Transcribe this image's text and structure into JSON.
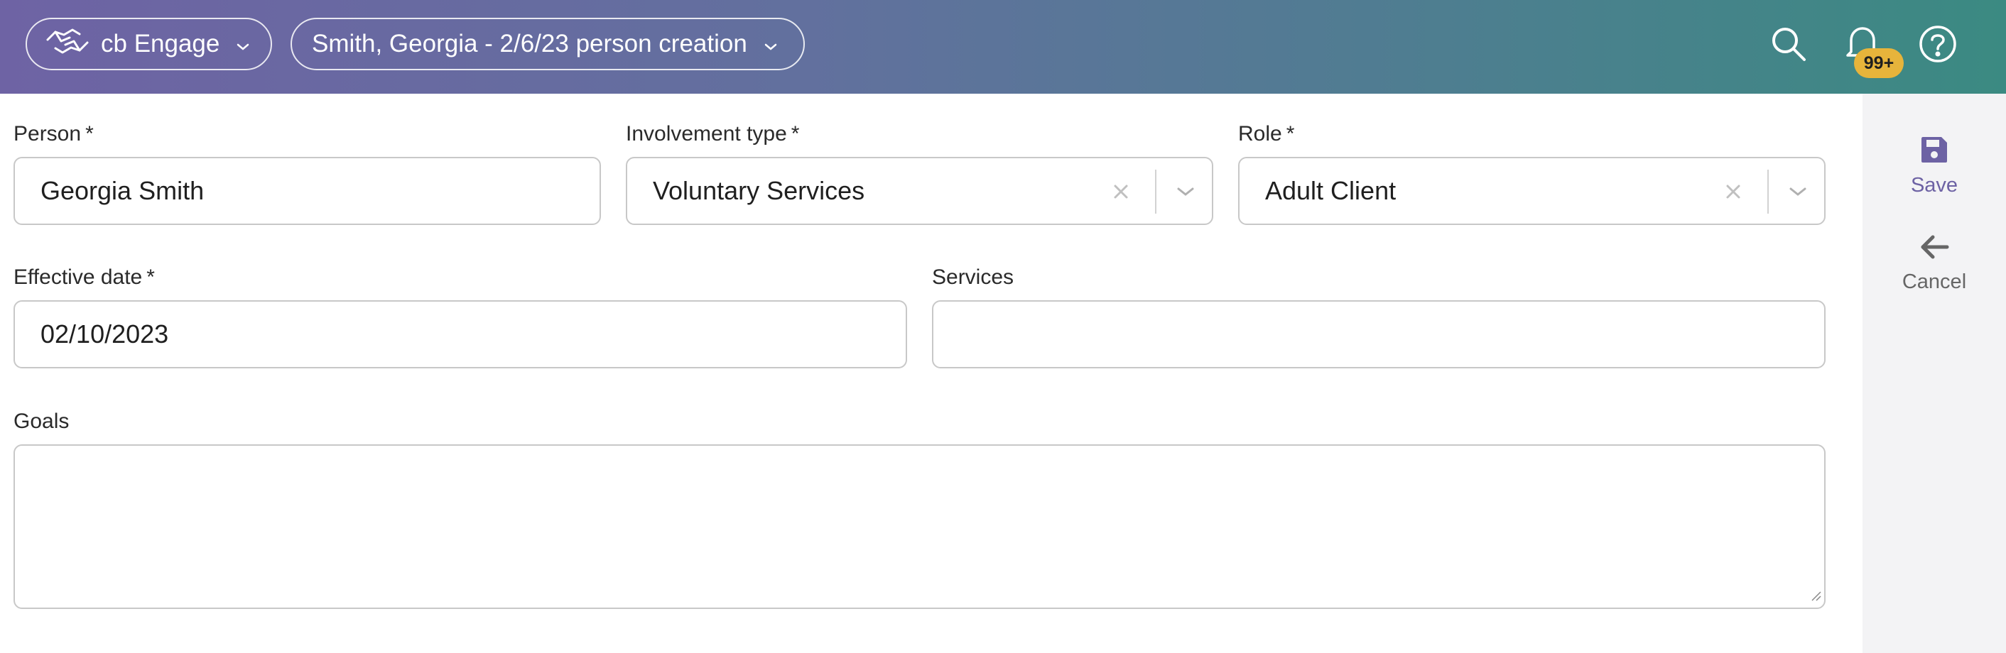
{
  "topbar": {
    "app_name": "cb Engage",
    "context_label": "Smith, Georgia - 2/6/23 person creation",
    "notifications_badge": "99+",
    "icons": [
      "handshake-icon",
      "chevron-down-icon",
      "search-icon",
      "bell-icon",
      "help-icon"
    ]
  },
  "form": {
    "person": {
      "label": "Person",
      "required": "*",
      "value": "Georgia Smith"
    },
    "involvement_type": {
      "label": "Involvement type",
      "required": "*",
      "value": "Voluntary Services"
    },
    "role": {
      "label": "Role",
      "required": "*",
      "value": "Adult Client"
    },
    "effective_date": {
      "label": "Effective date",
      "required": "*",
      "value": "02/10/2023"
    },
    "services": {
      "label": "Services",
      "value": ""
    },
    "goals": {
      "label": "Goals",
      "value": ""
    }
  },
  "actions": {
    "save_label": "Save",
    "cancel_label": "Cancel"
  },
  "colors": {
    "topbar_gradient_start": "#6e63a4",
    "topbar_gradient_end": "#3b8a82",
    "badge": "#e7b43b",
    "accent": "#6d62a4"
  }
}
